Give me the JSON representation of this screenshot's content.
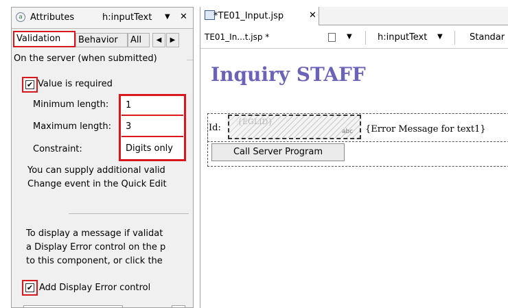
{
  "left_panel": {
    "header": {
      "title": "Attributes",
      "component": "h:inputText",
      "menu_glyph": "▼",
      "close_glyph": "✕"
    },
    "tabs": [
      {
        "label": "Validation",
        "active": true
      },
      {
        "label": "Behavior",
        "active": false
      },
      {
        "label": "All",
        "active": false
      }
    ],
    "section_heading": "On the server (when submitted)",
    "value_required": {
      "label": "Value is required",
      "checked": true
    },
    "fields": [
      {
        "label": "Minimum length:",
        "value": "1"
      },
      {
        "label": "Maximum length:",
        "value": "3"
      },
      {
        "label": "Constraint:",
        "value": "Digits only"
      }
    ],
    "help_text_1": [
      "You can supply additional valid",
      "Change event in the Quick Edit"
    ],
    "help_text_2": [
      "To display a message if validat",
      "a Display Error control on the p",
      "to this component, or click the"
    ],
    "add_display_error": {
      "label": "Add Display Error control",
      "checked": true
    }
  },
  "editor": {
    "tab_label": "*TE01_Input.jsp",
    "toolbar": {
      "file_label": "TE01_In...t.jsp *",
      "component_select": "h:inputText",
      "mode_label": "Standar"
    },
    "page_heading": "Inquiry STAFF",
    "id_label": "Id:",
    "input_placeholder": "{EGLID}",
    "input_badge": "abc",
    "error_message": "{Error Message for text1}",
    "button_label": "Call Server Program"
  },
  "colors": {
    "highlight_red": "#d8161c",
    "heading_purple": "#6a63b8"
  }
}
